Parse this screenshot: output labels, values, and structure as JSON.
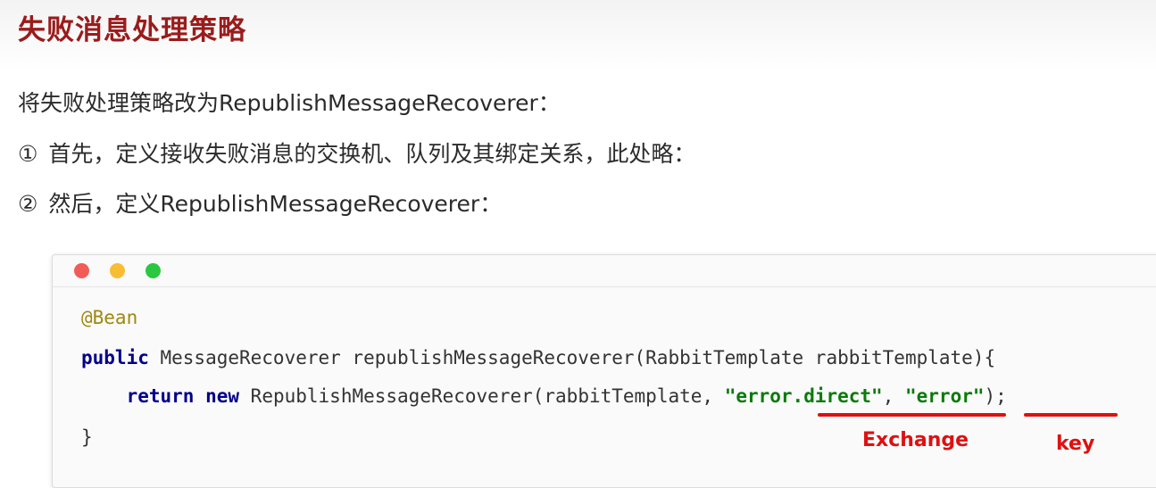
{
  "title": "失败消息处理策略",
  "intro": "将失败处理策略改为RepublishMessageRecoverer：",
  "steps": [
    {
      "marker": "①",
      "text": "首先，定义接收失败消息的交换机、队列及其绑定关系，此处略："
    },
    {
      "marker": "②",
      "text": "然后，定义RepublishMessageRecoverer："
    }
  ],
  "code": {
    "line1": "@Bean",
    "line2_kw": "public",
    "line2_rest": " MessageRecoverer republishMessageRecoverer(RabbitTemplate rabbitTemplate){",
    "line3_indent": "    ",
    "line3_kw1": "return",
    "line3_sp": " ",
    "line3_kw2": "new",
    "line3_mid": " RepublishMessageRecoverer(rabbitTemplate, ",
    "line3_str1": "\"error.direct\"",
    "line3_sep": ", ",
    "line3_str2": "\"error\"",
    "line3_end": ");",
    "line4": "}"
  },
  "annotations": {
    "exchange_label": "Exchange",
    "key_label": "key",
    "color": "#e01010"
  }
}
